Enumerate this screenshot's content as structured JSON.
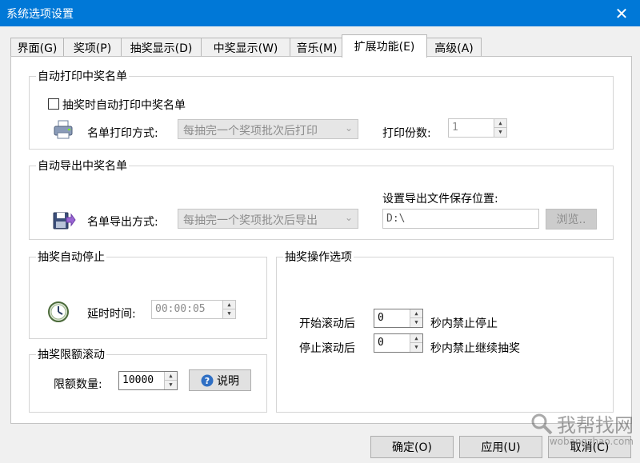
{
  "window": {
    "title": "系统选项设置",
    "close_label": "✕"
  },
  "tabs": [
    {
      "label": "界面(G)"
    },
    {
      "label": "奖项(P)"
    },
    {
      "label": "抽奖显示(D)"
    },
    {
      "label": "中奖显示(W)"
    },
    {
      "label": "音乐(M)"
    },
    {
      "label": "扩展功能(E)"
    },
    {
      "label": "高级(A)"
    }
  ],
  "auto_print": {
    "group_label": "自动打印中奖名单",
    "checkbox_label": "抽奖时自动打印中奖名单",
    "method_label": "名单打印方式:",
    "method_value": "每抽完一个奖项批次后打印",
    "copies_label": "打印份数:",
    "copies_value": "1"
  },
  "auto_export": {
    "group_label": "自动导出中奖名单",
    "method_label": "名单导出方式:",
    "method_value": "每抽完一个奖项批次后导出",
    "location_label": "设置导出文件保存位置:",
    "location_value": "D:\\",
    "browse_label": "浏览.."
  },
  "auto_stop": {
    "group_label": "抽奖自动停止",
    "delay_label": "延时时间:",
    "delay_value": "00:00:05"
  },
  "quota": {
    "group_label": "抽奖限额滚动",
    "count_label": "限额数量:",
    "count_value": "10000",
    "help_label": "说明"
  },
  "operation": {
    "group_label": "抽奖操作选项",
    "start_prefix": "开始滚动后",
    "start_value": "0",
    "start_suffix": "秒内禁止停止",
    "stop_prefix": "停止滚动后",
    "stop_value": "0",
    "stop_suffix": "秒内禁止继续抽奖"
  },
  "footer": {
    "ok_label": "确定(O)",
    "apply_label": "应用(U)",
    "cancel_label": "取消(C)"
  },
  "watermark": {
    "text": "我帮找网",
    "url": "wobangzhao.com"
  },
  "colors": {
    "titlebar": "#0078d7",
    "help_icon": "#2f6fc4"
  },
  "icons": {
    "close": "close-icon",
    "printer": "printer-icon",
    "export": "export-icon",
    "clock": "clock-icon",
    "help": "help-icon",
    "spin_up": "spin-up-icon",
    "spin_down": "spin-down-icon",
    "dropdown": "chevron-down-icon"
  }
}
